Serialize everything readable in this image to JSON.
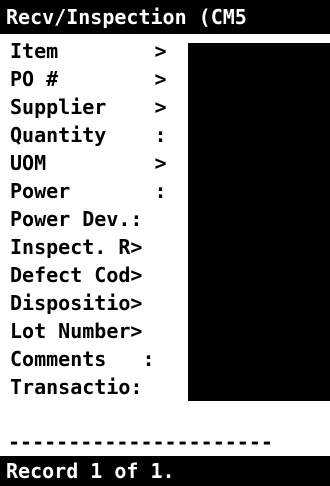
{
  "title": "Recv/Inspection (CM5",
  "fields": [
    {
      "label": "Item        >",
      "value": ""
    },
    {
      "label": "PO #        >",
      "value": ""
    },
    {
      "label": "Supplier    >",
      "value": ""
    },
    {
      "label": "Quantity    :",
      "value": ""
    },
    {
      "label": "UOM         >",
      "value": ""
    },
    {
      "label": "Power       :",
      "value": ""
    },
    {
      "label": "Power Dev.:",
      "value": ""
    },
    {
      "label": "Inspect. R>",
      "value": ""
    },
    {
      "label": "Defect Cod>",
      "value": ""
    },
    {
      "label": "Dispositio>",
      "value": ""
    },
    {
      "label": "Lot Number>",
      "value": ""
    },
    {
      "label": "Comments   :",
      "value": ""
    },
    {
      "label": "Transactio:",
      "value": ""
    }
  ],
  "separator": "----------------------",
  "status": "Record 1 of 1.",
  "colors": {
    "foreground": "#000000",
    "background": "#ffffff",
    "inverse_background": "#000000",
    "inverse_foreground": "#ffffff"
  }
}
